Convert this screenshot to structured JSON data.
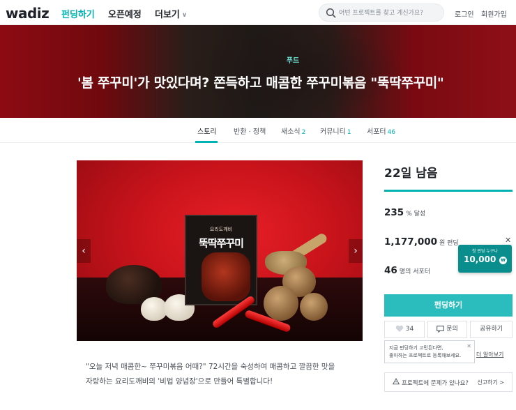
{
  "header": {
    "logo": "wadiz",
    "nav": [
      {
        "label": "펀딩하기"
      },
      {
        "label": "오픈예정"
      },
      {
        "label": "더보기"
      }
    ],
    "search_placeholder": "어떤 프로젝트를 찾고 계신가요?",
    "login": "로그인",
    "signup": "회원가입"
  },
  "hero": {
    "category": "푸드",
    "title": "'봄 쭈꾸미'가 맛있다며? 쫀득하고 매콤한 쭈꾸미볶음 \"뚝딱쭈꾸미\""
  },
  "tabs": [
    {
      "label": "스토리",
      "count": ""
    },
    {
      "label": "반환 · 정책",
      "count": ""
    },
    {
      "label": "새소식",
      "count": "2"
    },
    {
      "label": "커뮤니티",
      "count": "1"
    },
    {
      "label": "서포터",
      "count": "46"
    }
  ],
  "product_image": {
    "package_brand": "요리도깨비",
    "package_name": "뚝딱쭈꾸미"
  },
  "description": {
    "line1": "\"오늘 저녁 매콤한~ 쭈꾸미볶음 어때?\" 72시간을 숙성하여 매콤하고 깔끔한 맛을",
    "line2": "자랑하는 요리도깨비의 '비법 양념장'으로 만들어 특별합니다!"
  },
  "side": {
    "days_left": "22일 남음",
    "progress_percent": 235,
    "progress_value": "235",
    "progress_unit": "% 달성",
    "amount_value": "1,177,000",
    "amount_unit": "원 펀딩",
    "supporters_value": "46",
    "supporters_unit": "명의 서포터",
    "fund_button": "펀딩하기",
    "like_count": "34",
    "inquiry": "문의",
    "share": "공유하기",
    "tooltip_line1": "지금 펀딩하기 고민된다면,",
    "tooltip_line2": "좋아하는 프로젝트로 등록해보세요.",
    "tooltip_link": "더 알아보기",
    "report_text": "프로젝트에 문제가 있나요?",
    "report_link": "신고하기 >"
  },
  "ad_badge": {
    "top": "첫 펀딩 누구나",
    "amount": "10,000"
  },
  "colors": {
    "accent": "#00b2b2",
    "fund_button": "#2bbdbd",
    "hero_red": "#c4101a"
  }
}
